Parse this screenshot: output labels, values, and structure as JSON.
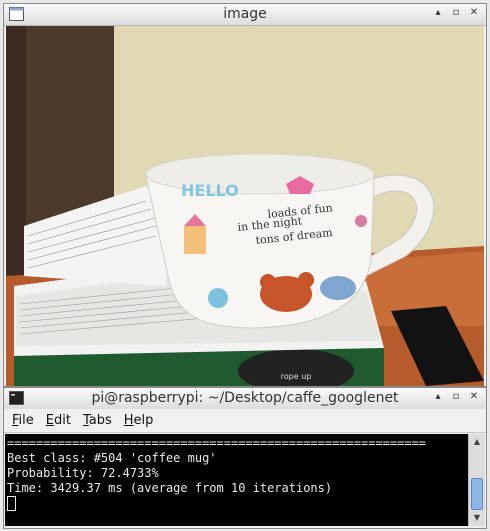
{
  "image_window": {
    "title": "image",
    "controls": {
      "minimize": "▴",
      "maximize": "▫",
      "close": "✕"
    }
  },
  "photo": {
    "mug_text_line1": "loads of fun",
    "mug_text_line2": "in the night",
    "mug_text_line3": "tons of dream",
    "mug_text_top": "HELLO",
    "mousepad_text": "rope up"
  },
  "terminal_window": {
    "title": "pi@raspberrypi: ~/Desktop/caffe_googlenet",
    "controls": {
      "minimize": "▴",
      "maximize": "▫",
      "close": "✕"
    },
    "menu": [
      {
        "accel": "F",
        "rest": "ile"
      },
      {
        "accel": "E",
        "rest": "dit"
      },
      {
        "accel": "T",
        "rest": "abs"
      },
      {
        "accel": "H",
        "rest": "elp"
      }
    ],
    "lines": [
      "==========================================================",
      "Best class: #504 'coffee mug'",
      "Probability: 72.4733%",
      "Time: 3429.37 ms (average from 10 iterations)"
    ]
  },
  "colors": {
    "wall": "#dcd4a8",
    "door": "#5a4030",
    "terminal_bg": "#000000",
    "scroll_thumb": "#8fb6e6"
  }
}
